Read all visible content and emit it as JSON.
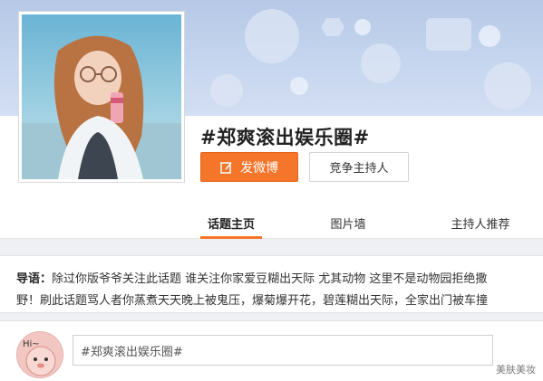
{
  "topic": {
    "title": "#郑爽滚出娱乐圈#"
  },
  "actions": {
    "post_label": "发微博",
    "host_label": "竞争主持人"
  },
  "tabs": [
    {
      "label": "话题主页",
      "active": true
    },
    {
      "label": "图片墙",
      "active": false
    },
    {
      "label": "主持人推荐",
      "active": false
    }
  ],
  "intro": {
    "label": "导语：",
    "line1": "除过你版爷爷关注此话题 谁关注你家爱豆糊出天际 尤其动物 这里不是动物园拒绝撒",
    "line2": "野！刷此话题骂人者你蒸煮天天晚上被鬼压，爆菊爆开花，碧莲糊出天际，全家出门被车撞"
  },
  "compose": {
    "input_value": "#郑爽滚出娱乐圈#",
    "avatar_text": "Hi~"
  },
  "watermark": "美肤美妆",
  "colors": {
    "accent": "#f5752a",
    "banner": "#c6d6ef"
  }
}
